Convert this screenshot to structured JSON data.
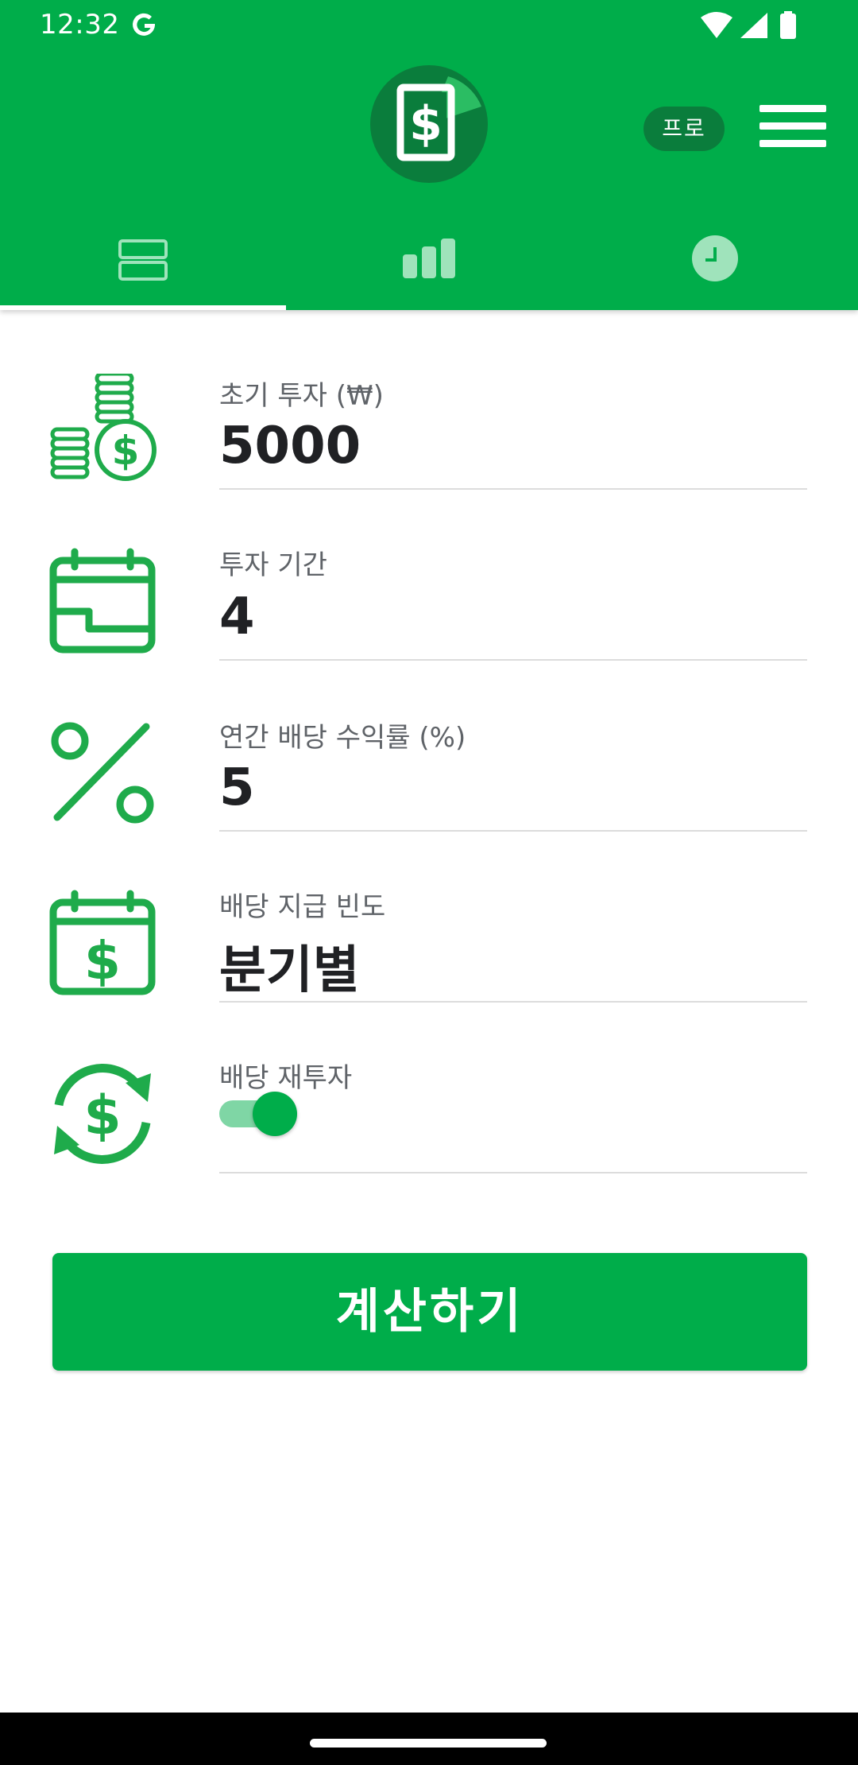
{
  "status_bar": {
    "time": "12:32",
    "google_icon": "google-g-icon",
    "wifi_icon": "wifi-icon",
    "signal_icon": "cell-signal-icon",
    "battery_icon": "battery-icon"
  },
  "header": {
    "logo_icon": "dollar-document-logo-icon",
    "pro_badge": "프로",
    "menu_icon": "hamburger-menu-icon"
  },
  "tabs": [
    {
      "icon": "form-rows-icon",
      "selected": true
    },
    {
      "icon": "bar-chart-icon",
      "selected": false
    },
    {
      "icon": "clock-history-icon",
      "selected": false
    }
  ],
  "form": {
    "initial_investment": {
      "label": "초기 투자 (₩)",
      "value": "5000",
      "icon": "coins-dollar-icon"
    },
    "investment_period": {
      "label": "투자 기간",
      "value": "4",
      "icon": "calendar-period-icon"
    },
    "annual_dividend_yield": {
      "label": "연간 배당 수익률 (%)",
      "value": "5",
      "icon": "percent-icon"
    },
    "payment_frequency": {
      "label": "배당 지급 빈도",
      "value": "분기별",
      "icon": "calendar-dollar-icon"
    },
    "dividend_reinvestment": {
      "label": "배당 재투자",
      "enabled": true,
      "icon": "dollar-refresh-icon"
    }
  },
  "calculate_button": {
    "label": "계산하기"
  },
  "colors": {
    "primary": "#00ad4a",
    "primary_dark": "#0a7d3c",
    "toggle_track": "#7fd6a5",
    "icon_green": "#1fab4b"
  }
}
